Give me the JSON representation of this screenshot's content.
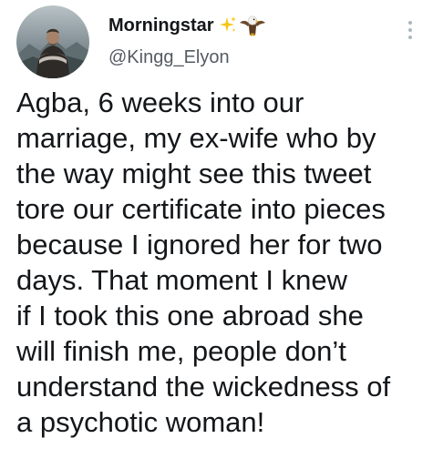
{
  "author": {
    "display_name": "Morningstar",
    "handle": "@Kingg_Elyon",
    "badge_icons": [
      "sparkles-icon",
      "eagle-icon"
    ]
  },
  "menu": {
    "icon": "more-options-icon"
  },
  "tweet": {
    "lines": [
      "Agba, 6 weeks into our",
      "marriage, my ex-wife who by",
      "the way might see this tweet",
      "tore our certificate into pieces",
      "because I ignored her for two",
      "days. That moment I knew",
      "if I took this one abroad she",
      "will finish me, people don’t",
      "understand the wickedness of",
      "a psychotic woman!"
    ]
  },
  "colors": {
    "text": "#14171a",
    "secondary_text": "#555b63",
    "sparkle": "#f5c518",
    "background": "#ffffff"
  }
}
